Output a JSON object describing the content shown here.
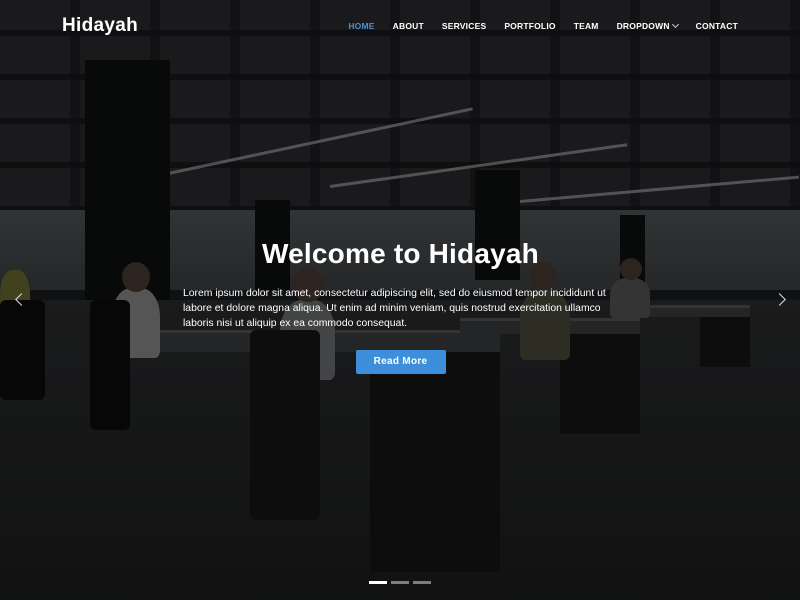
{
  "header": {
    "logo": "Hidayah",
    "nav": [
      {
        "label": "HOME",
        "active": true
      },
      {
        "label": "ABOUT",
        "active": false
      },
      {
        "label": "SERVICES",
        "active": false
      },
      {
        "label": "PORTFOLIO",
        "active": false
      },
      {
        "label": "TEAM",
        "active": false
      },
      {
        "label": "DROPDOWN",
        "active": false,
        "icon": "chevron-down-icon"
      },
      {
        "label": "CONTACT",
        "active": false
      }
    ]
  },
  "hero": {
    "title": "Welcome to Hidayah",
    "description": "Lorem ipsum dolor sit amet, consectetur adipiscing elit, sed do eiusmod tempor incididunt ut labore et dolore magna aliqua. Ut enim ad minim veniam, quis nostrud exercitation ullamco laboris nisi ut aliquip ex ea commodo consequat.",
    "button_label": "Read More",
    "prev_icon": "chevron-left-icon",
    "next_icon": "chevron-right-icon",
    "slides": 3,
    "active_slide": 1
  },
  "colors": {
    "accent": "#3d8fdc",
    "active_nav": "#4a90d9",
    "overlay": "rgba(0,0,0,0.38)"
  }
}
